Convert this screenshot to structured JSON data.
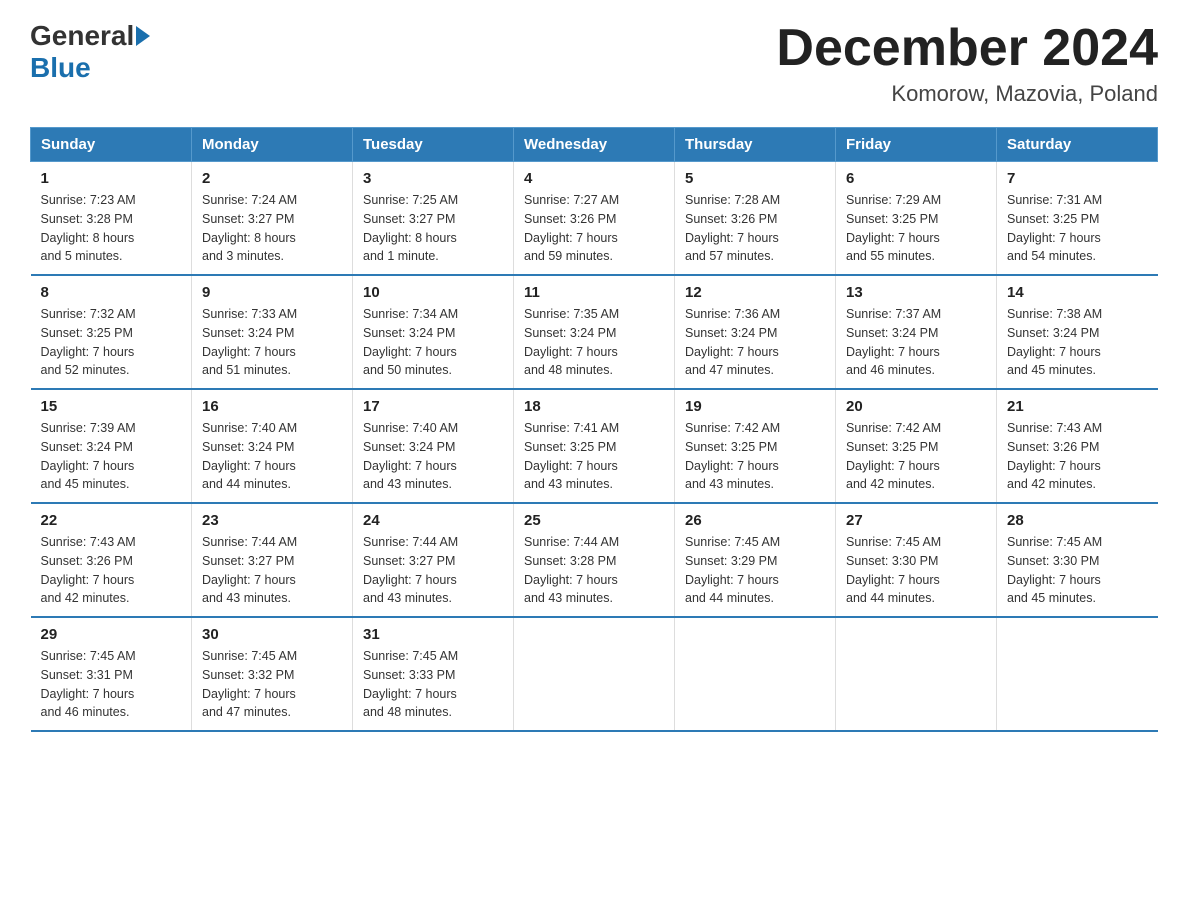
{
  "logo": {
    "general": "General",
    "blue": "Blue"
  },
  "title": "December 2024",
  "subtitle": "Komorow, Mazovia, Poland",
  "days_of_week": [
    "Sunday",
    "Monday",
    "Tuesday",
    "Wednesday",
    "Thursday",
    "Friday",
    "Saturday"
  ],
  "weeks": [
    [
      {
        "day": "1",
        "sunrise": "7:23 AM",
        "sunset": "3:28 PM",
        "daylight": "8 hours and 5 minutes."
      },
      {
        "day": "2",
        "sunrise": "7:24 AM",
        "sunset": "3:27 PM",
        "daylight": "8 hours and 3 minutes."
      },
      {
        "day": "3",
        "sunrise": "7:25 AM",
        "sunset": "3:27 PM",
        "daylight": "8 hours and 1 minute."
      },
      {
        "day": "4",
        "sunrise": "7:27 AM",
        "sunset": "3:26 PM",
        "daylight": "7 hours and 59 minutes."
      },
      {
        "day": "5",
        "sunrise": "7:28 AM",
        "sunset": "3:26 PM",
        "daylight": "7 hours and 57 minutes."
      },
      {
        "day": "6",
        "sunrise": "7:29 AM",
        "sunset": "3:25 PM",
        "daylight": "7 hours and 55 minutes."
      },
      {
        "day": "7",
        "sunrise": "7:31 AM",
        "sunset": "3:25 PM",
        "daylight": "7 hours and 54 minutes."
      }
    ],
    [
      {
        "day": "8",
        "sunrise": "7:32 AM",
        "sunset": "3:25 PM",
        "daylight": "7 hours and 52 minutes."
      },
      {
        "day": "9",
        "sunrise": "7:33 AM",
        "sunset": "3:24 PM",
        "daylight": "7 hours and 51 minutes."
      },
      {
        "day": "10",
        "sunrise": "7:34 AM",
        "sunset": "3:24 PM",
        "daylight": "7 hours and 50 minutes."
      },
      {
        "day": "11",
        "sunrise": "7:35 AM",
        "sunset": "3:24 PM",
        "daylight": "7 hours and 48 minutes."
      },
      {
        "day": "12",
        "sunrise": "7:36 AM",
        "sunset": "3:24 PM",
        "daylight": "7 hours and 47 minutes."
      },
      {
        "day": "13",
        "sunrise": "7:37 AM",
        "sunset": "3:24 PM",
        "daylight": "7 hours and 46 minutes."
      },
      {
        "day": "14",
        "sunrise": "7:38 AM",
        "sunset": "3:24 PM",
        "daylight": "7 hours and 45 minutes."
      }
    ],
    [
      {
        "day": "15",
        "sunrise": "7:39 AM",
        "sunset": "3:24 PM",
        "daylight": "7 hours and 45 minutes."
      },
      {
        "day": "16",
        "sunrise": "7:40 AM",
        "sunset": "3:24 PM",
        "daylight": "7 hours and 44 minutes."
      },
      {
        "day": "17",
        "sunrise": "7:40 AM",
        "sunset": "3:24 PM",
        "daylight": "7 hours and 43 minutes."
      },
      {
        "day": "18",
        "sunrise": "7:41 AM",
        "sunset": "3:25 PM",
        "daylight": "7 hours and 43 minutes."
      },
      {
        "day": "19",
        "sunrise": "7:42 AM",
        "sunset": "3:25 PM",
        "daylight": "7 hours and 43 minutes."
      },
      {
        "day": "20",
        "sunrise": "7:42 AM",
        "sunset": "3:25 PM",
        "daylight": "7 hours and 42 minutes."
      },
      {
        "day": "21",
        "sunrise": "7:43 AM",
        "sunset": "3:26 PM",
        "daylight": "7 hours and 42 minutes."
      }
    ],
    [
      {
        "day": "22",
        "sunrise": "7:43 AM",
        "sunset": "3:26 PM",
        "daylight": "7 hours and 42 minutes."
      },
      {
        "day": "23",
        "sunrise": "7:44 AM",
        "sunset": "3:27 PM",
        "daylight": "7 hours and 43 minutes."
      },
      {
        "day": "24",
        "sunrise": "7:44 AM",
        "sunset": "3:27 PM",
        "daylight": "7 hours and 43 minutes."
      },
      {
        "day": "25",
        "sunrise": "7:44 AM",
        "sunset": "3:28 PM",
        "daylight": "7 hours and 43 minutes."
      },
      {
        "day": "26",
        "sunrise": "7:45 AM",
        "sunset": "3:29 PM",
        "daylight": "7 hours and 44 minutes."
      },
      {
        "day": "27",
        "sunrise": "7:45 AM",
        "sunset": "3:30 PM",
        "daylight": "7 hours and 44 minutes."
      },
      {
        "day": "28",
        "sunrise": "7:45 AM",
        "sunset": "3:30 PM",
        "daylight": "7 hours and 45 minutes."
      }
    ],
    [
      {
        "day": "29",
        "sunrise": "7:45 AM",
        "sunset": "3:31 PM",
        "daylight": "7 hours and 46 minutes."
      },
      {
        "day": "30",
        "sunrise": "7:45 AM",
        "sunset": "3:32 PM",
        "daylight": "7 hours and 47 minutes."
      },
      {
        "day": "31",
        "sunrise": "7:45 AM",
        "sunset": "3:33 PM",
        "daylight": "7 hours and 48 minutes."
      },
      null,
      null,
      null,
      null
    ]
  ],
  "labels": {
    "sunrise": "Sunrise:",
    "sunset": "Sunset:",
    "daylight": "Daylight:"
  }
}
